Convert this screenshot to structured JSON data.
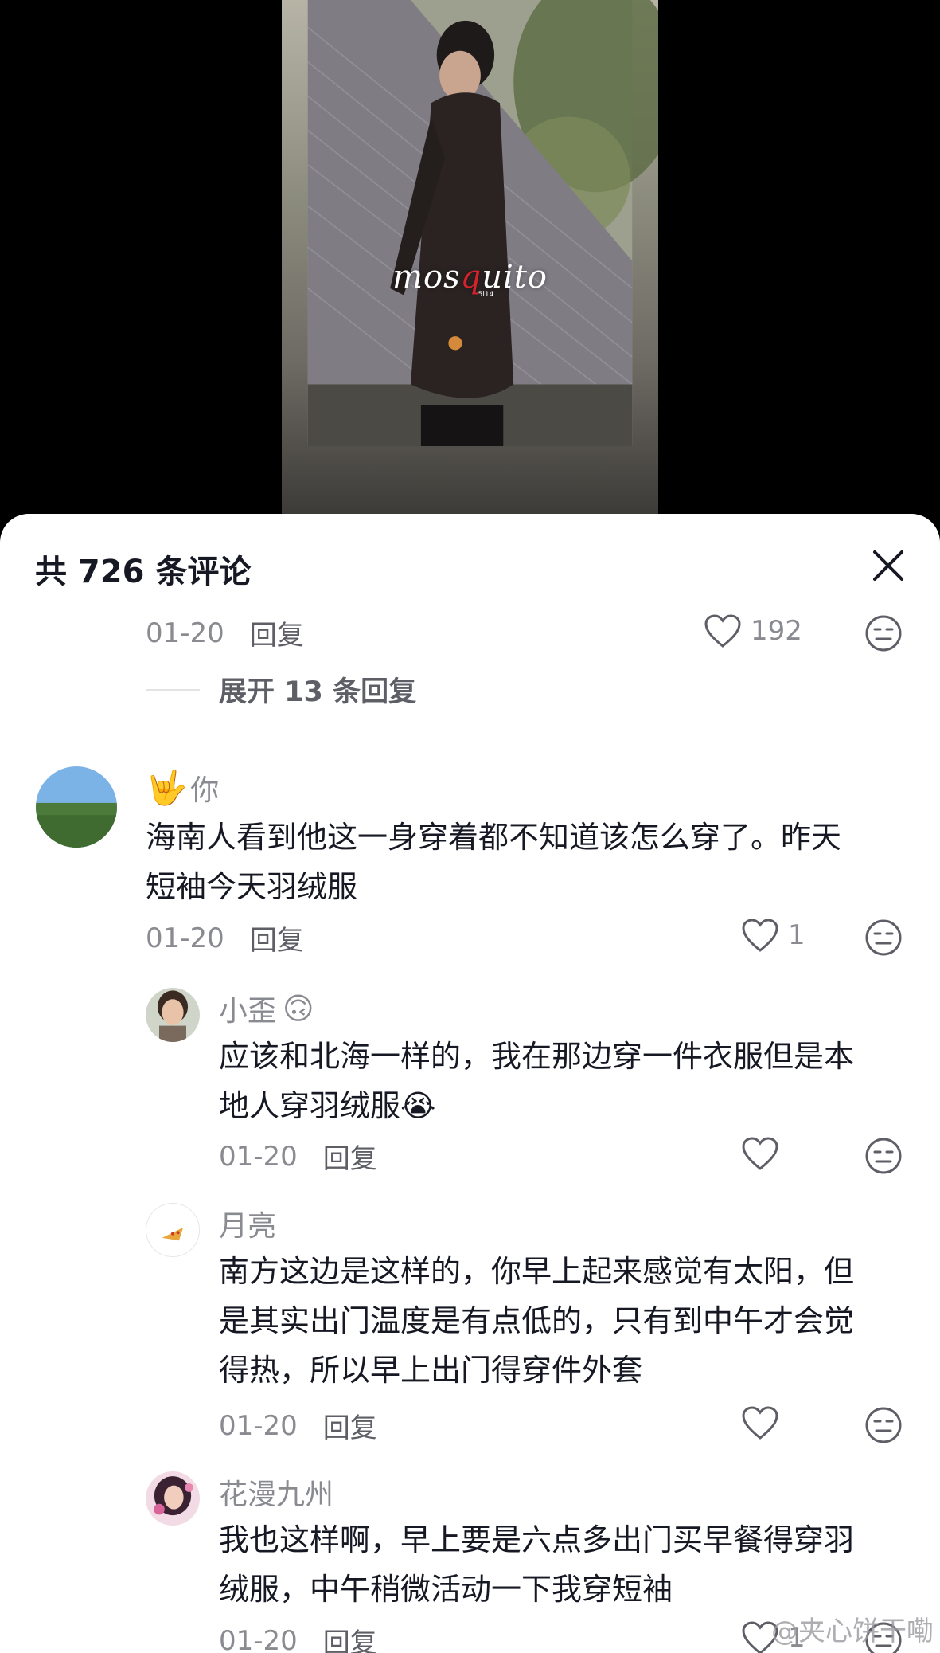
{
  "video": {
    "watermark_main": "mosquito",
    "watermark_sub": "5i14"
  },
  "sheet": {
    "title": "共 726 条评论"
  },
  "comments": [
    {
      "date": "01-20",
      "reply_label": "回复",
      "likes": "192",
      "expand_label": "展开 13 条回复"
    },
    {
      "name": "你",
      "text_lines": [
        "海南人看到他这一身穿着都不知道该怎么穿了。昨天",
        "短袖今天羽绒服"
      ],
      "date": "01-20",
      "reply_label": "回复",
      "likes": "1",
      "name_emoji": "🤟"
    },
    {
      "name": "小歪",
      "text_lines": [
        "应该和北海一样的，我在那边穿一件衣服但是本",
        "地人穿羽绒服"
      ],
      "date": "01-20",
      "reply_label": "回复",
      "name_emoji": "🙃"
    },
    {
      "name": "月亮",
      "text_lines": [
        "南方这边是这样的，你早上起来感觉有太阳，但",
        "是其实出门温度是有点低的，只有到中午才会觉",
        "得热，所以早上出门得穿件外套"
      ],
      "date": "01-20",
      "reply_label": "回复"
    },
    {
      "name": "花漫九州",
      "text_lines": [
        "我也这样啊，早上要是六点多出门买早餐得穿羽",
        "绒服，中午稍微活动一下我穿短袖"
      ],
      "date": "01-20",
      "reply_label": "回复",
      "likes": "1"
    }
  ],
  "corner_watermark": "@夹心饼干嘞",
  "colors": {
    "text_primary": "#161823",
    "text_secondary": "#8a8b91",
    "background": "#ffffff"
  }
}
